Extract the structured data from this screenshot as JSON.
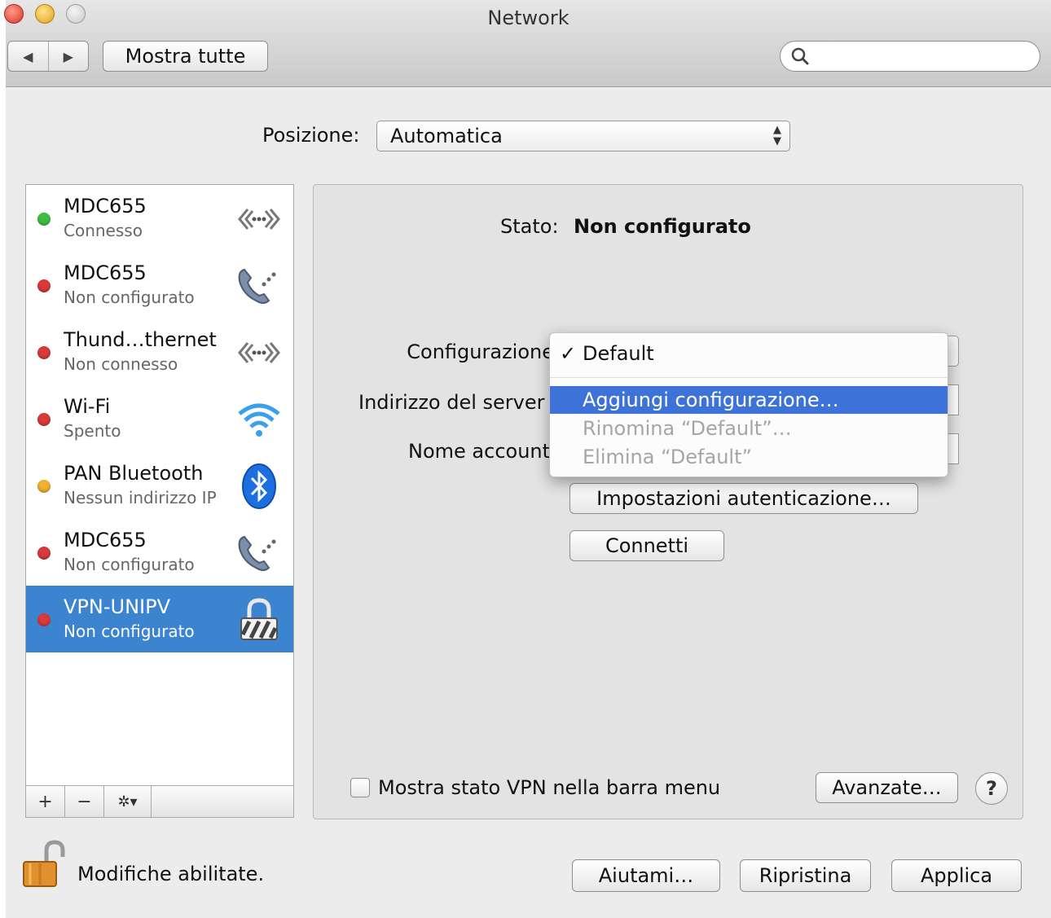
{
  "window": {
    "title": "Network"
  },
  "toolbar": {
    "back_label": "◀",
    "forward_label": "▶",
    "show_all_label": "Mostra tutte",
    "search_value": ""
  },
  "location": {
    "label": "Posizione:",
    "value": "Automatica"
  },
  "services": [
    {
      "name": "MDC655",
      "status": "Connesso",
      "status_color": "#3fbf3f",
      "icon": "ethernet-icon"
    },
    {
      "name": "MDC655",
      "status": "Non configurato",
      "status_color": "#d93a3a",
      "icon": "modem-phone-icon"
    },
    {
      "name": "Thund…thernet",
      "status": "Non connesso",
      "status_color": "#d93a3a",
      "icon": "ethernet-icon"
    },
    {
      "name": "Wi-Fi",
      "status": "Spento",
      "status_color": "#d93a3a",
      "icon": "wifi-icon"
    },
    {
      "name": "PAN Bluetooth",
      "status": "Nessun indirizzo IP",
      "status_color": "#f0b030",
      "icon": "bluetooth-icon"
    },
    {
      "name": "MDC655",
      "status": "Non configurato",
      "status_color": "#d93a3a",
      "icon": "modem-phone-icon"
    },
    {
      "name": "VPN-UNIPV",
      "status": "Non configurato",
      "status_color": "#d93a3a",
      "icon": "vpn-lock-icon"
    }
  ],
  "sidebar_actions": {
    "add": "+",
    "remove": "−",
    "gear": "✲▾"
  },
  "detail": {
    "status_label": "Stato:",
    "status_value": "Non configurato",
    "config_label": "Configurazione",
    "server_label": "Indirizzo del server",
    "account_label": "Nome account",
    "auth_button": "Impostazioni autenticazione…",
    "connect_button": "Connetti",
    "show_vpn_label": "Mostra stato VPN nella barra menu",
    "advanced_button": "Avanzate…",
    "help_label": "?"
  },
  "config_menu": {
    "checkmark": "✓",
    "items": [
      "Default",
      "Aggiungi configurazione…",
      "Rinomina “Default”…",
      "Elimina “Default”"
    ]
  },
  "footer": {
    "lock_label": "Modifiche abilitate.",
    "assist_button": "Aiutami…",
    "revert_button": "Ripristina",
    "apply_button": "Applica"
  },
  "colors": {
    "selection": "#3c83d0",
    "menu_highlight": "#3d73d8"
  }
}
